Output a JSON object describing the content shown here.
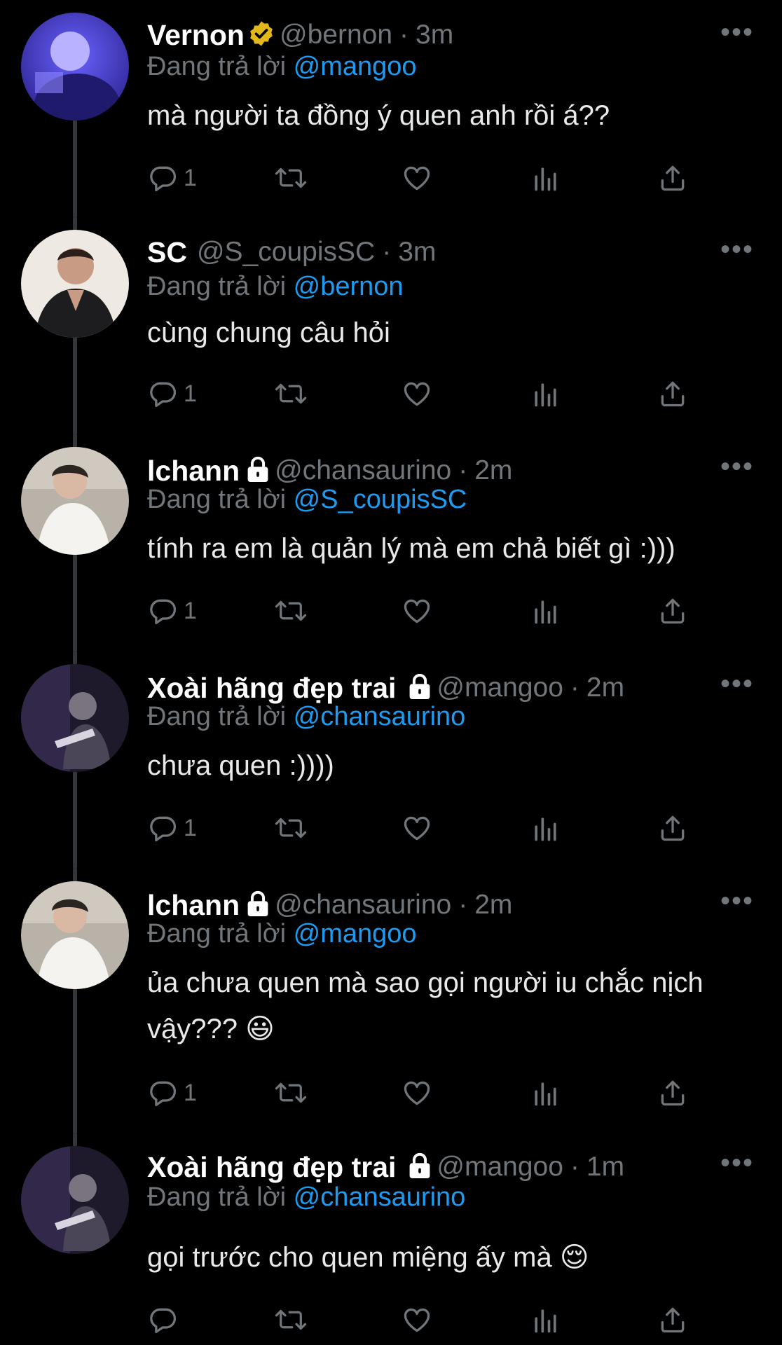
{
  "replying_label": "Đang trả lời",
  "dot": "·",
  "more_label": "•••",
  "tweets": [
    {
      "name": "Vernon",
      "handle": "@bernon",
      "time": "3m",
      "verified": true,
      "locked": false,
      "replying_to": "@mangoo",
      "text": "mà người ta đồng ý quen anh rồi á??",
      "reply_count": "1"
    },
    {
      "name": "SC",
      "handle": "@S_coupisSC",
      "time": "3m",
      "verified": false,
      "locked": false,
      "replying_to": "@bernon",
      "text": "cùng chung câu hỏi",
      "reply_count": "1"
    },
    {
      "name": "lchann",
      "handle": "@chansaurino",
      "time": "2m",
      "verified": false,
      "locked": true,
      "replying_to": "@S_coupisSC",
      "text": "tính ra em là quản lý mà em chả biết gì :)))",
      "reply_count": "1"
    },
    {
      "name": "Xoài hãng đẹp trai",
      "handle": "@mangoo",
      "time": "2m",
      "verified": false,
      "locked": true,
      "replying_to": "@chansaurino",
      "text": "chưa quen :))))",
      "reply_count": "1"
    },
    {
      "name": "lchann",
      "handle": "@chansaurino",
      "time": "2m",
      "verified": false,
      "locked": true,
      "replying_to": "@mangoo",
      "text_line1": "ủa chưa quen mà sao gọi người iu chắc nịch",
      "text_line2": "vậy???",
      "text_emoji": "😃",
      "reply_count": "1"
    },
    {
      "name": "Xoài hãng đẹp trai",
      "handle": "@mangoo",
      "time": "1m",
      "verified": false,
      "locked": true,
      "replying_to": "@chansaurino",
      "text": "gọi trước cho quen miệng ấy mà",
      "text_emoji": "😌",
      "reply_count": ""
    }
  ],
  "colors": {
    "background": "#000000",
    "secondary_text": "#71767b",
    "link": "#1d9bf0",
    "verified": "#e2b719",
    "thread_line": "#333639"
  },
  "icons": [
    "reply-icon",
    "retweet-icon",
    "like-icon",
    "views-icon",
    "share-icon",
    "verified-badge-icon",
    "lock-icon",
    "more-icon"
  ]
}
